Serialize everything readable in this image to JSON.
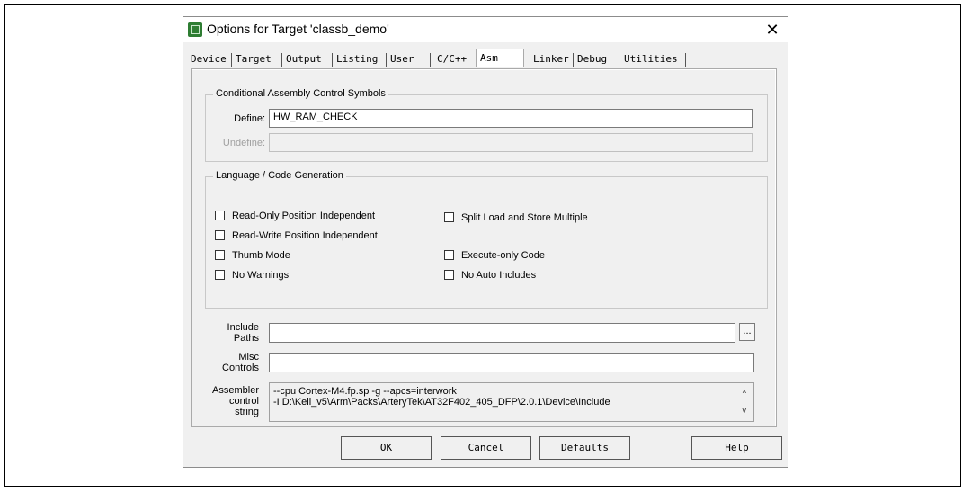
{
  "dialog": {
    "title": "Options for Target 'classb_demo'",
    "close_glyph": "✕"
  },
  "tabs": [
    {
      "label": "Device"
    },
    {
      "label": "Target"
    },
    {
      "label": "Output"
    },
    {
      "label": "Listing"
    },
    {
      "label": "User"
    },
    {
      "label": "C/C++"
    },
    {
      "label": "Asm",
      "active": true
    },
    {
      "label": "Linker"
    },
    {
      "label": "Debug"
    },
    {
      "label": "Utilities"
    }
  ],
  "conditional": {
    "group_label": "Conditional Assembly Control Symbols",
    "define_label": "Define:",
    "define_value": "HW_RAM_CHECK",
    "undefine_label": "Undefine:",
    "undefine_value": ""
  },
  "language": {
    "group_label": "Language / Code Generation",
    "options": [
      {
        "label": "Read-Only Position Independent",
        "checked": false
      },
      {
        "label": "Read-Write Position Independent",
        "checked": false
      },
      {
        "label": "Thumb Mode",
        "checked": false
      },
      {
        "label": "No Warnings",
        "checked": false
      },
      {
        "label": "Split Load and Store Multiple",
        "checked": false
      },
      {
        "label": "Execute-only Code",
        "checked": false
      },
      {
        "label": "No Auto Includes",
        "checked": false
      }
    ]
  },
  "include_paths": {
    "label_line1": "Include",
    "label_line2": "Paths",
    "value": "",
    "browse_label": "..."
  },
  "misc_controls": {
    "label_line1": "Misc",
    "label_line2": "Controls",
    "value": ""
  },
  "assembler": {
    "label_line1": "Assembler",
    "label_line2": "control",
    "label_line3": "string",
    "line1": "--cpu Cortex-M4.fp.sp -g --apcs=interwork",
    "line2": "-I D:\\Keil_v5\\Arm\\Packs\\ArteryTek\\AT32F402_405_DFP\\2.0.1\\Device\\Include",
    "scroll_up": "^",
    "scroll_down": "v"
  },
  "buttons": {
    "ok": "OK",
    "cancel": "Cancel",
    "defaults": "Defaults",
    "help": "Help"
  }
}
